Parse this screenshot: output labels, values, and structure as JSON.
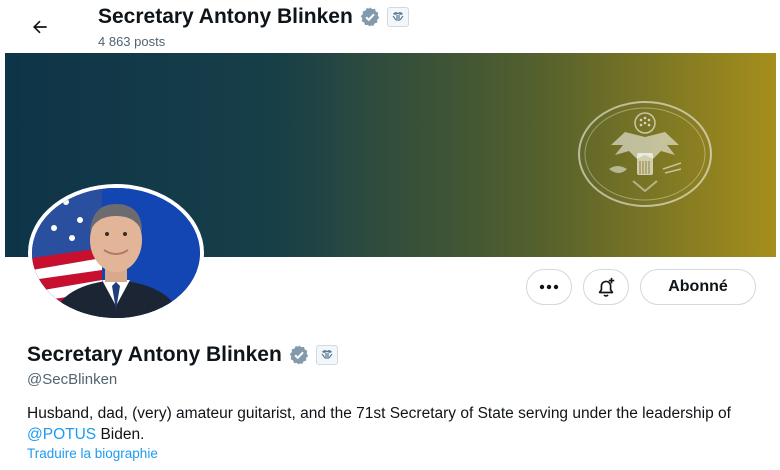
{
  "header": {
    "title": "Secretary Antony Blinken",
    "posts_count": "4 863 posts"
  },
  "profile": {
    "name": "Secretary Antony Blinken",
    "handle": "@SecBlinken",
    "bio_before": "Husband, dad, (very) amateur guitarist, and the 71st Secretary of State serving under the leadership of ",
    "bio_mention": "@POTUS",
    "bio_after": " Biden.",
    "translate_label": "Traduire la biographie"
  },
  "actions": {
    "more_icon": "ellipsis-icon",
    "notify_icon": "bell-plus-icon",
    "follow_label": "Abonné"
  },
  "icons": {
    "back": "arrow-left-icon",
    "verified": "verified-badge-icon",
    "government": "government-label-icon",
    "banner_seal": "state-department-seal-icon"
  },
  "colors": {
    "verified": "#829aab",
    "link": "#1d9bf0",
    "secondary_text": "#536471",
    "banner_left": "#0e3448",
    "banner_right": "#a68e1c"
  }
}
